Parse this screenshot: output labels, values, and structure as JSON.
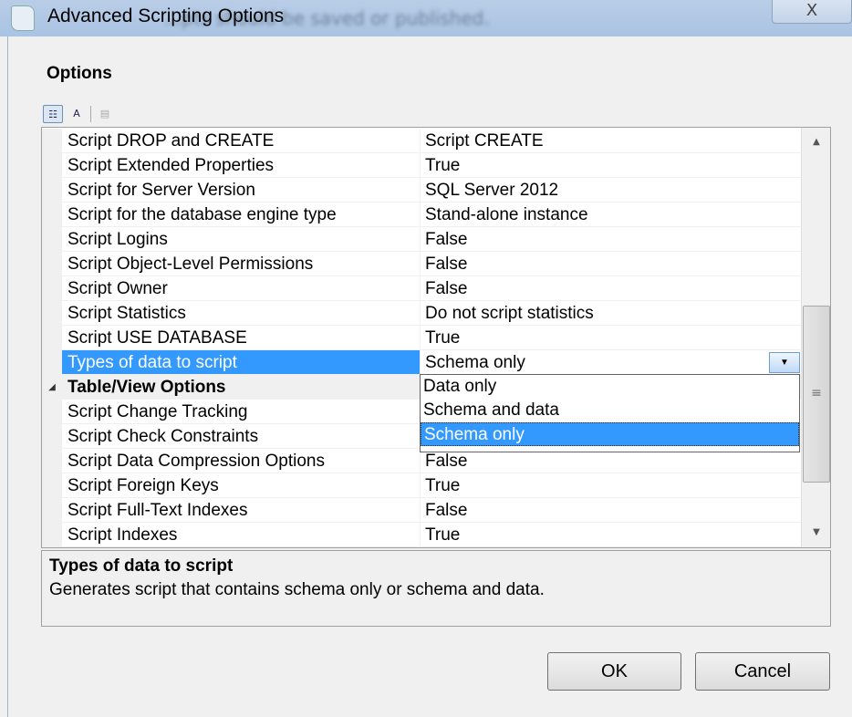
{
  "window": {
    "title": "Advanced Scripting Options",
    "background_text": "...pts should be saved or published.",
    "close_label": "X"
  },
  "options_label": "Options",
  "toolbar": {
    "categorized": "categorized-icon",
    "alphabetical": "A Z↓",
    "property_pages": "property-pages-icon"
  },
  "rows": [
    {
      "name": "Script DROP and CREATE",
      "value": "Script CREATE"
    },
    {
      "name": "Script Extended Properties",
      "value": "True"
    },
    {
      "name": "Script for Server Version",
      "value": "SQL Server 2012"
    },
    {
      "name": "Script for the database engine type",
      "value": "Stand-alone instance"
    },
    {
      "name": "Script Logins",
      "value": "False"
    },
    {
      "name": "Script Object-Level Permissions",
      "value": "False"
    },
    {
      "name": "Script Owner",
      "value": "False"
    },
    {
      "name": "Script Statistics",
      "value": "Do not script statistics"
    },
    {
      "name": "Script USE DATABASE",
      "value": "True"
    },
    {
      "name": "Types of data to script",
      "value": "Schema only",
      "selected": true
    },
    {
      "name": "Table/View Options",
      "value": "",
      "category": true
    },
    {
      "name": "Script Change Tracking",
      "value": ""
    },
    {
      "name": "Script Check Constraints",
      "value": ""
    },
    {
      "name": "Script Data Compression Options",
      "value": "False"
    },
    {
      "name": "Script Foreign Keys",
      "value": "True"
    },
    {
      "name": "Script Full-Text Indexes",
      "value": "False"
    },
    {
      "name": "Script Indexes",
      "value": "True"
    }
  ],
  "dropdown": {
    "options": [
      "Data only",
      "Schema and data",
      "Schema only"
    ],
    "selected": "Schema only"
  },
  "description": {
    "title": "Types of data to script",
    "text": "Generates script that contains schema only or schema and data."
  },
  "buttons": {
    "ok": "OK",
    "cancel": "Cancel"
  },
  "colors": {
    "selection": "#3399ff",
    "titlebar": "#b9cde6"
  }
}
